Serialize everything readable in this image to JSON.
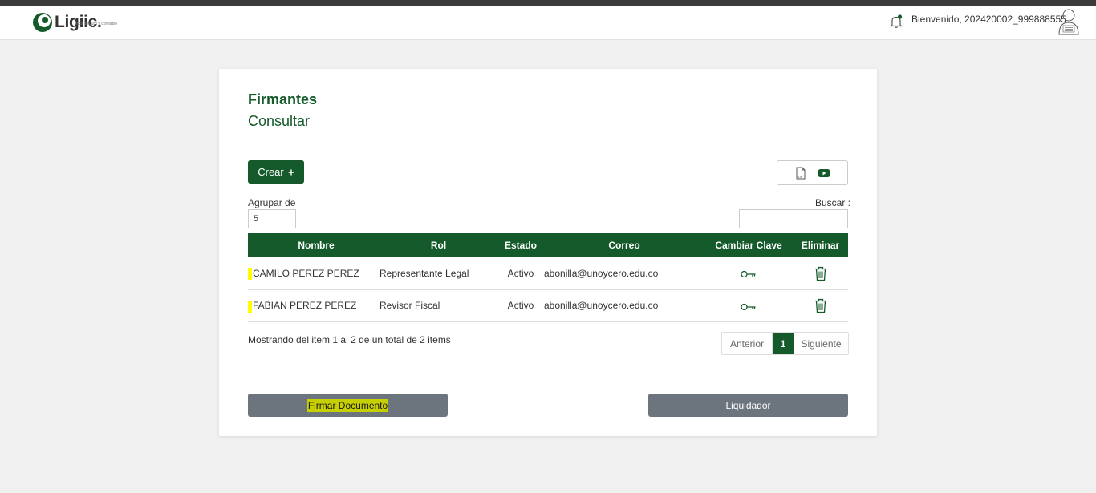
{
  "header": {
    "logo_name": "Ligiic.",
    "logo_tagline": "fácil, seguro y confiable",
    "welcome_text": "Bienvenido, 202420002_999888555",
    "brand_color": "#145a2a"
  },
  "card": {
    "title": "Firmantes",
    "subtitle": "Consultar",
    "create_label": "Crear",
    "create_icon": "plus-icon",
    "toolbar_icons": [
      "pdf-icon",
      "youtube-icon"
    ],
    "group_label": "Agrupar de",
    "group_value": "5",
    "search_label": "Buscar :",
    "search_value": ""
  },
  "table": {
    "columns": [
      "Nombre",
      "Rol",
      "Estado",
      "Correo",
      "Cambiar Clave",
      "Eliminar"
    ],
    "rows": [
      {
        "nombre": "CAMILO PEREZ PEREZ",
        "rol": "Representante Legal",
        "estado": "Activo",
        "correo": "abonilla@unoycero.edu.co"
      },
      {
        "nombre": "FABIAN PEREZ PEREZ",
        "rol": "Revisor Fiscal",
        "estado": "Activo",
        "correo": "abonilla@unoycero.edu.co"
      }
    ]
  },
  "pagination": {
    "info": "Mostrando del item 1 al 2 de un total de 2 items",
    "prev": "Anterior",
    "current": "1",
    "next": "Siguiente"
  },
  "actions": {
    "sign_label": "Firmar Documento",
    "liquidator_label": "Liquidador"
  }
}
